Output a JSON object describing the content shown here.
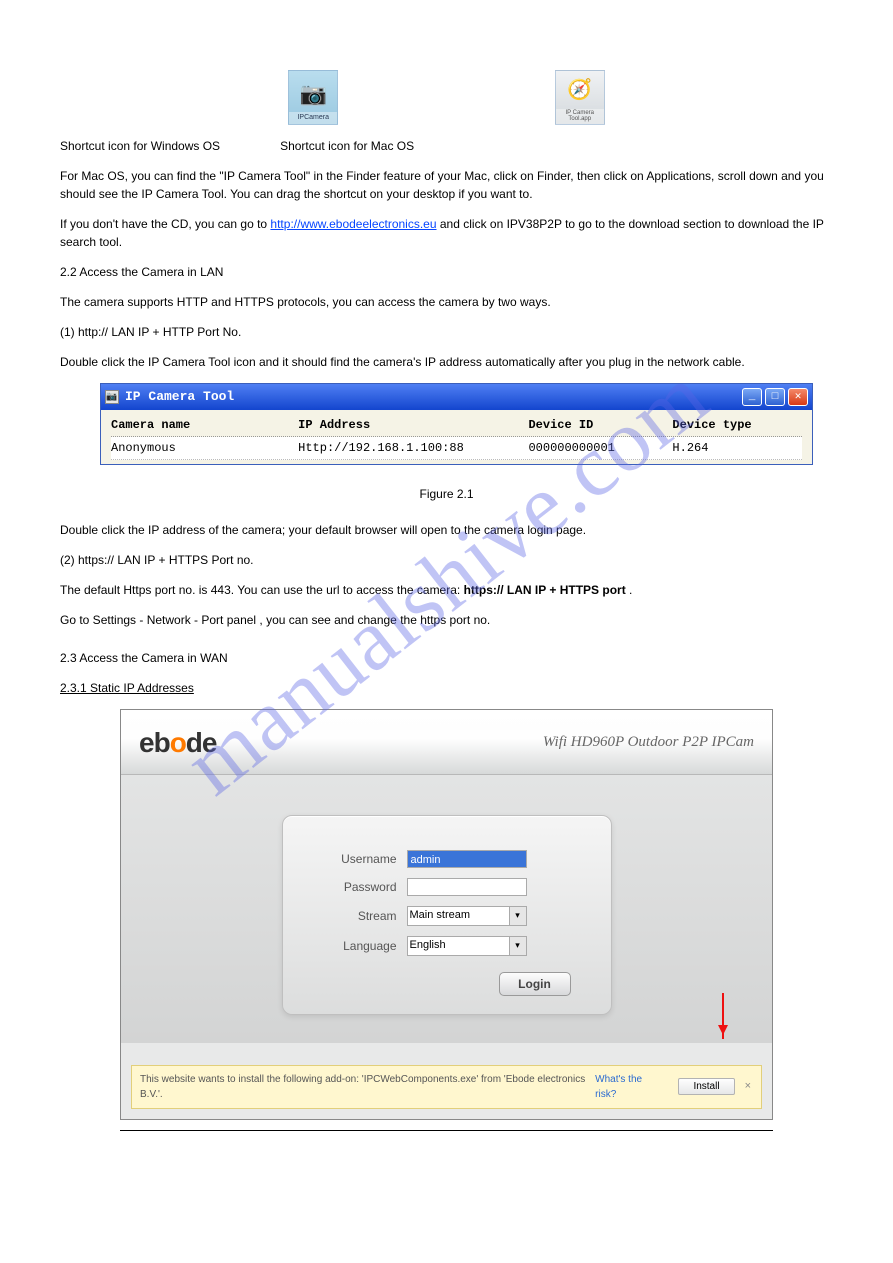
{
  "watermark": "manualshive.com",
  "icons": {
    "win_label": "IPCamera",
    "mac_label": "IP Camera Tool.app"
  },
  "text": {
    "shortcut_win_prefix": "Shortcut icon for Windows OS",
    "shortcut_mac_prefix": "Shortcut icon for Mac OS",
    "para1_a": "For Mac OS, you can find the \"IP Camera Tool\" in the Finder feature of your Mac, click on Finder, then click on Applications, scroll down and you should see the IP Camera Tool. You can drag the shortcut on your desktop if you want to.",
    "para1_b": "If you don't have the CD, you can go to ",
    "link_text": "http://www.ebodeelectronics.eu",
    "para1_c": " and click on IPV38P2P to go to the download section to download the IP search tool.",
    "h_22": "2.2 Access the Camera in LAN",
    "para2": "The camera supports HTTP and HTTPS protocols, you can access the camera by two ways.",
    "h_221": "(1) http:// LAN IP + HTTP Port No.",
    "para3": "Double click the IP Camera Tool icon and it should find the camera's IP address automatically after you plug in the network cable.",
    "fig21": "Figure 2.1",
    "para4": "Double click the IP address of the camera; your default browser will open to the camera login page.",
    "h_222": "(2) https:// LAN IP + HTTPS Port no.",
    "para5_a": "The default Https port no. is 443. You can use the url to access the camera: ",
    "para5_b": "https:// LAN IP + HTTPS port",
    "para5_c": ".",
    "para6": "Go to Settings - Network - Port panel , you can see and change the https port no.",
    "h_23": "2.3 Access the Camera in WAN",
    "h_231": "2.3.1 Static IP Addresses"
  },
  "ip_tool": {
    "title": "IP Camera Tool",
    "headers": {
      "h1": "Camera name",
      "h2": "IP Address",
      "h3": "Device ID",
      "h4": "Device type"
    },
    "row": {
      "c1": "Anonymous",
      "c2": "Http://192.168.1.100:88",
      "c3": "000000000001",
      "c4": "H.264"
    }
  },
  "login_ui": {
    "brand_plain_1": "eb",
    "brand_accent": "o",
    "brand_plain_2": "de",
    "subtitle": "Wifi HD960P Outdoor P2P IPCam",
    "labels": {
      "user": "Username",
      "pass": "Password",
      "stream": "Stream",
      "lang": "Language"
    },
    "values": {
      "user": "admin",
      "stream": "Main stream",
      "lang": "English"
    },
    "login_btn": "Login",
    "addon_msg": "This website wants to install the following add-on: 'IPCWebComponents.exe' from 'Ebode electronics B.V.'.",
    "risk": "What's the risk?",
    "install": "Install",
    "close": "×"
  }
}
